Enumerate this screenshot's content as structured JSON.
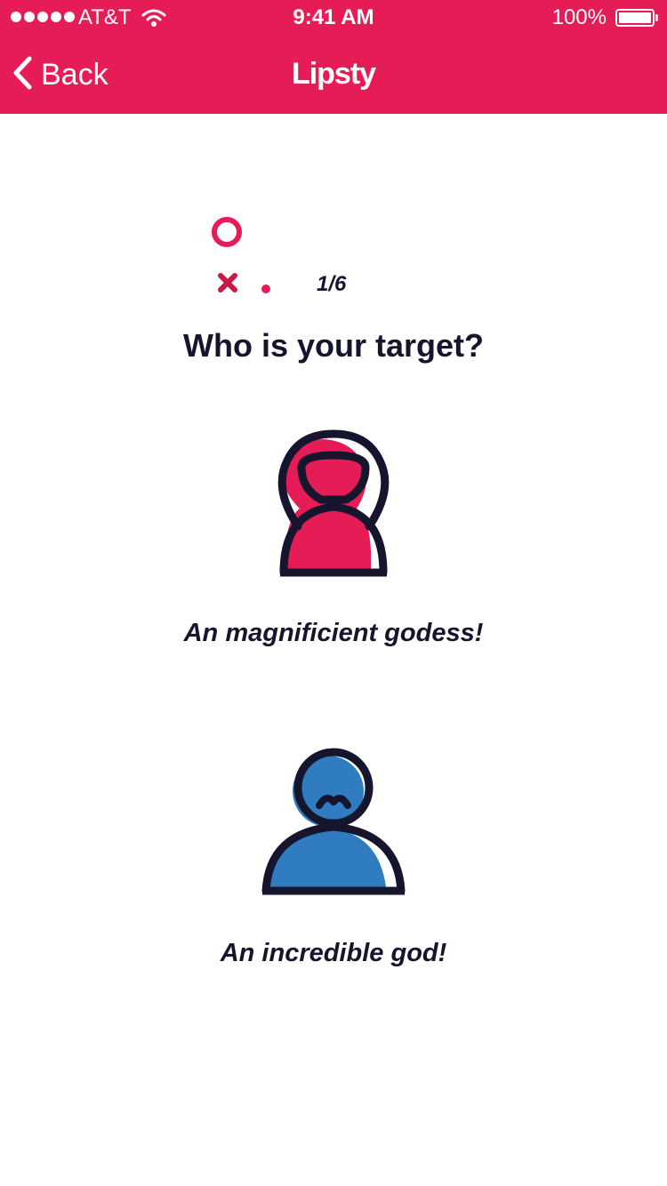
{
  "status_bar": {
    "carrier": "AT&T",
    "time": "9:41 AM",
    "battery": "100%",
    "battery_level": 1.0
  },
  "nav": {
    "back_label": "Back",
    "title": "Lipsty"
  },
  "progress": {
    "step_text": "1/6"
  },
  "question": "Who is your target?",
  "options": [
    {
      "label": "An magnificient godess!",
      "icon": "female-avatar-icon",
      "color": "#e61c57"
    },
    {
      "label": "An incredible god!",
      "icon": "male-avatar-icon",
      "color": "#2f7dc0"
    }
  ],
  "colors": {
    "primary": "#e61c57",
    "male_accent": "#2f7dc0",
    "ink": "#15152e",
    "background": "#ffffff"
  }
}
